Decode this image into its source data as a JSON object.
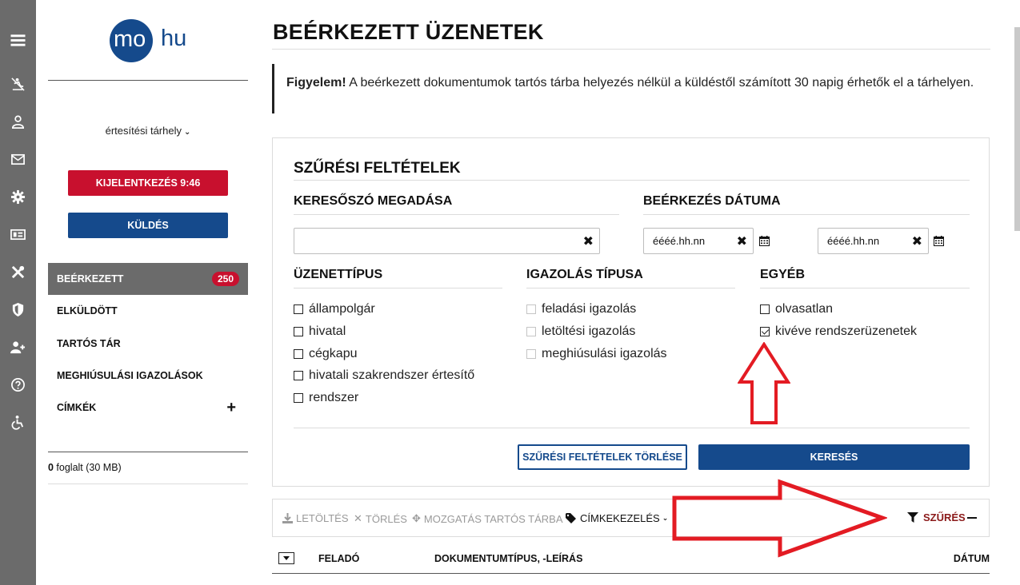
{
  "logo": {
    "circle_text": "mo",
    "suffix": "hu"
  },
  "sidebar": {
    "account_label": "értesítési tárhely",
    "logout_label": "KIJELENTKEZÉS 9:46",
    "send_label": "KÜLDÉS",
    "nav": [
      {
        "label": "BEÉRKEZETT",
        "badge": "250"
      },
      {
        "label": "ELKÜLDÖTT"
      },
      {
        "label": "TARTÓS TÁR"
      },
      {
        "label": "MEGHIÚSULÁSI IGAZOLÁSOK"
      },
      {
        "label": "CÍMKÉK",
        "action": "+"
      }
    ],
    "storage_count": "0",
    "storage_text": " foglalt (30 MB)"
  },
  "rail_icons": [
    "menu-icon",
    "crossed-person-icon",
    "user-icon",
    "envelope-icon",
    "gear-icon",
    "card-icon",
    "tools-icon",
    "shield-icon",
    "add-user-icon",
    "help-icon",
    "accessibility-icon"
  ],
  "main": {
    "title": "BEÉRKEZETT ÜZENETEK",
    "notice_bold": "Figyelem!",
    "notice_text": " A beérkezett dokumentumok tartós tárba helyezés nélkül a küldéstől számított 30 napig érhetők el a tárhelyen."
  },
  "filters": {
    "title": "SZŰRÉSI FELTÉTELEK",
    "keyword_title": "KERESŐSZÓ MEGADÁSA",
    "keyword_value": "",
    "date_title": "BEÉRKEZÉS DÁTUMA",
    "date_from_placeholder": "éééé.hh.nn",
    "date_to_placeholder": "éééé.hh.nn",
    "clear_symbol": "✖",
    "message_type_title": "ÜZENETTÍPUS",
    "message_types": [
      "állampolgár",
      "hivatal",
      "cégkapu",
      "hivatali szakrendszer értesítő",
      "rendszer"
    ],
    "proof_type_title": "IGAZOLÁS TÍPUSA",
    "proof_types": [
      "feladási igazolás",
      "letöltési igazolás",
      "meghiúsulási igazolás"
    ],
    "other_title": "EGYÉB",
    "other": [
      {
        "label": "olvasatlan",
        "checked": false
      },
      {
        "label": "kivéve rendszerüzenetek",
        "checked": true
      }
    ],
    "clear_button": "SZŰRÉSI FELTÉTELEK TÖRLÉSE",
    "search_button": "KERESÉS"
  },
  "toolbar": {
    "download": "LETÖLTÉS",
    "delete": "TÖRLÉS",
    "move": "MOZGATÁS TARTÓS TÁRBA",
    "labels": "CÍMKEKEZELÉS",
    "filter": "SZŰRÉS"
  },
  "table": {
    "columns": [
      "FELADÓ",
      "DOKUMENTUMTÍPUS, -LEÍRÁS",
      "DÁTUM"
    ]
  },
  "colors": {
    "brand_blue": "#154a8c",
    "alert_red": "#c8102e",
    "rail_gray": "#6b6b6b",
    "annotation_red": "#e31b23"
  }
}
